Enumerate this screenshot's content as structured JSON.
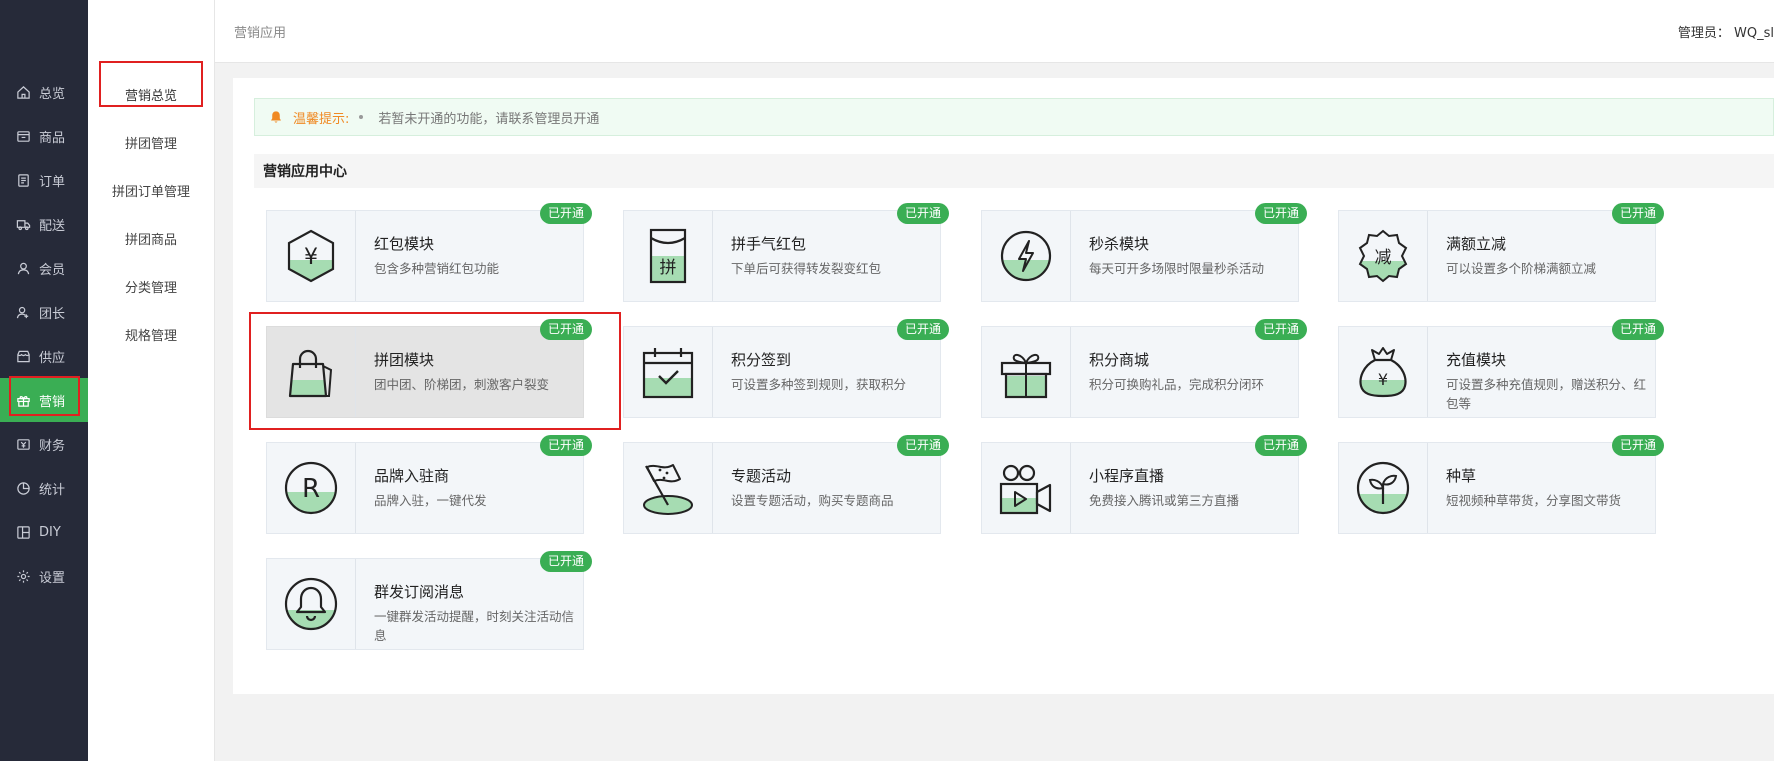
{
  "sidebar": {
    "items": [
      {
        "label": "总览",
        "icon": "home-icon"
      },
      {
        "label": "商品",
        "icon": "box-icon"
      },
      {
        "label": "订单",
        "icon": "order-icon"
      },
      {
        "label": "配送",
        "icon": "truck-icon"
      },
      {
        "label": "会员",
        "icon": "user-icon"
      },
      {
        "label": "团长",
        "icon": "leader-icon"
      },
      {
        "label": "供应",
        "icon": "store-icon"
      },
      {
        "label": "营销",
        "icon": "gift-icon",
        "active": true
      },
      {
        "label": "财务",
        "icon": "wallet-icon"
      },
      {
        "label": "统计",
        "icon": "pie-chart-icon"
      },
      {
        "label": "DIY",
        "icon": "layout-icon"
      },
      {
        "label": "设置",
        "icon": "gear-icon"
      }
    ]
  },
  "subsidebar": {
    "items": [
      {
        "label": "营销总览",
        "active": true
      },
      {
        "label": "拼团管理"
      },
      {
        "label": "拼团订单管理"
      },
      {
        "label": "拼团商品"
      },
      {
        "label": "分类管理"
      },
      {
        "label": "规格管理"
      }
    ]
  },
  "header": {
    "breadcrumb": "营销应用",
    "admin": "管理员： WQ_sl"
  },
  "tip": {
    "label": "温馨提示:",
    "text": "若暂未开通的功能，请联系管理员开通"
  },
  "section": {
    "title": "营销应用中心"
  },
  "apps": [
    {
      "title": "红包模块",
      "desc": "包含多种营销红包功能",
      "badge": "已开通",
      "icon": "red-envelope-icon"
    },
    {
      "title": "拼手气红包",
      "desc": "下单后可获得转发裂变红包",
      "badge": "已开通",
      "icon": "lucky-envelope-icon"
    },
    {
      "title": "秒杀模块",
      "desc": "每天可开多场限时限量秒杀活动",
      "badge": "已开通",
      "icon": "lightning-icon"
    },
    {
      "title": "满额立减",
      "desc": "可以设置多个阶梯满额立减",
      "badge": "已开通",
      "icon": "discount-icon"
    },
    {
      "title": "拼团模块",
      "desc": "团中团、阶梯团，刺激客户裂变",
      "badge": "已开通",
      "icon": "shopping-bag-icon"
    },
    {
      "title": "积分签到",
      "desc": "可设置多种签到规则，获取积分",
      "badge": "已开通",
      "icon": "calendar-check-icon"
    },
    {
      "title": "积分商城",
      "desc": "积分可换购礼品，完成积分闭环",
      "badge": "已开通",
      "icon": "gift-box-icon"
    },
    {
      "title": "充值模块",
      "desc": "可设置多种充值规则，赠送积分、红包等",
      "badge": "已开通",
      "icon": "money-bag-icon"
    },
    {
      "title": "品牌入驻商",
      "desc": "品牌入驻，一键代发",
      "badge": "已开通",
      "icon": "registered-icon"
    },
    {
      "title": "专题活动",
      "desc": "设置专题活动，购买专题商品",
      "badge": "已开通",
      "icon": "flag-icon"
    },
    {
      "title": "小程序直播",
      "desc": "免费接入腾讯或第三方直播",
      "badge": "已开通",
      "icon": "video-camera-icon"
    },
    {
      "title": "种草",
      "desc": "短视频种草带货，分享图文带货",
      "badge": "已开通",
      "icon": "sprout-icon"
    },
    {
      "title": "群发订阅消息",
      "desc": "一键群发活动提醒，时刻关注活动信息",
      "badge": "已开通",
      "icon": "bell-icon"
    }
  ],
  "colors": {
    "accent": "#3aae54",
    "sidebar_bg": "#262a39",
    "annotation": "#e02020",
    "tip_label": "#f08a24"
  }
}
